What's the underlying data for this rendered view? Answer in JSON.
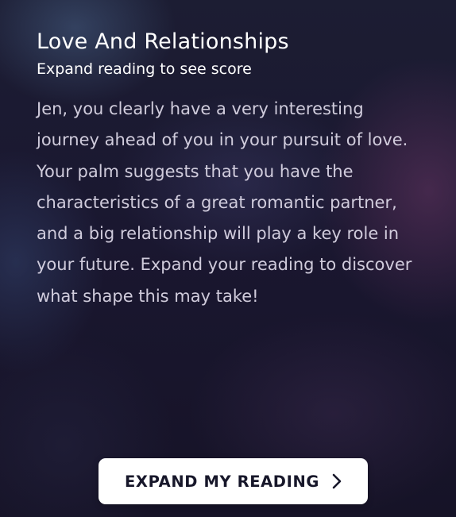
{
  "section": {
    "title": "Love And Relationships",
    "subtitle": "Expand reading to see score",
    "body": "Jen, you clearly have a very interesting journey ahead of you in your pursuit of love. Your palm suggests that you have the characteristics of a great romantic partner, and a big relationship will play a key role in your future. Expand your reading to discover what shape this may take!"
  },
  "cta": {
    "label": "EXPAND MY READING",
    "icon": "chevron-right-icon"
  },
  "colors": {
    "background": "#161327",
    "text": "#ffffff",
    "button_background": "#ffffff",
    "button_text": "#17172a"
  }
}
